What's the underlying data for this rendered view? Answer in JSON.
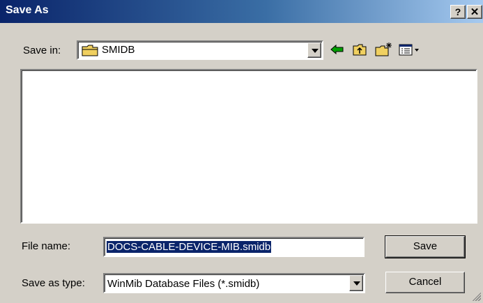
{
  "window": {
    "title": "Save As",
    "help_label": "?",
    "close_label": "✕"
  },
  "toolbar": {
    "save_in_label": "Save in:",
    "location": "SMIDB",
    "icons": [
      "back-arrow-icon",
      "up-folder-icon",
      "new-folder-icon",
      "view-menu-icon"
    ]
  },
  "file_list": {
    "items": []
  },
  "form": {
    "file_name_label": "File name:",
    "file_name_value": "DOCS-CABLE-DEVICE-MIB.smidb",
    "save_type_label": "Save as type:",
    "save_type_value": "WinMib Database Files (*.smidb)",
    "save_button": "Save",
    "cancel_button": "Cancel"
  },
  "colors": {
    "titlebar_start": "#0a246a",
    "titlebar_end": "#a6caf0",
    "selection": "#0a246a",
    "folder": "#f0d060"
  }
}
